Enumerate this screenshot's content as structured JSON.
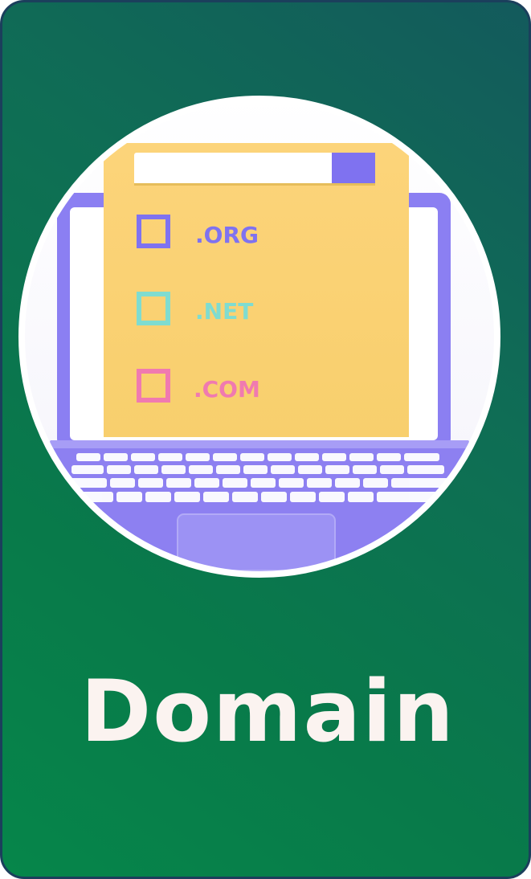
{
  "card": {
    "title": "Domain",
    "accent_color": "#06864a",
    "border_color": "#1b3f5c"
  },
  "illustration": {
    "icon": "laptop-domain-search-icon",
    "search_bar": {
      "text": "",
      "button_color": "#7f72f0"
    },
    "options": [
      {
        "label": ".ORG",
        "color": "#7f72f0",
        "checked": false
      },
      {
        "label": ".NET",
        "color": "#7fdcd0",
        "checked": false
      },
      {
        "label": ".COM",
        "color": "#f07ab0",
        "checked": false
      }
    ]
  }
}
